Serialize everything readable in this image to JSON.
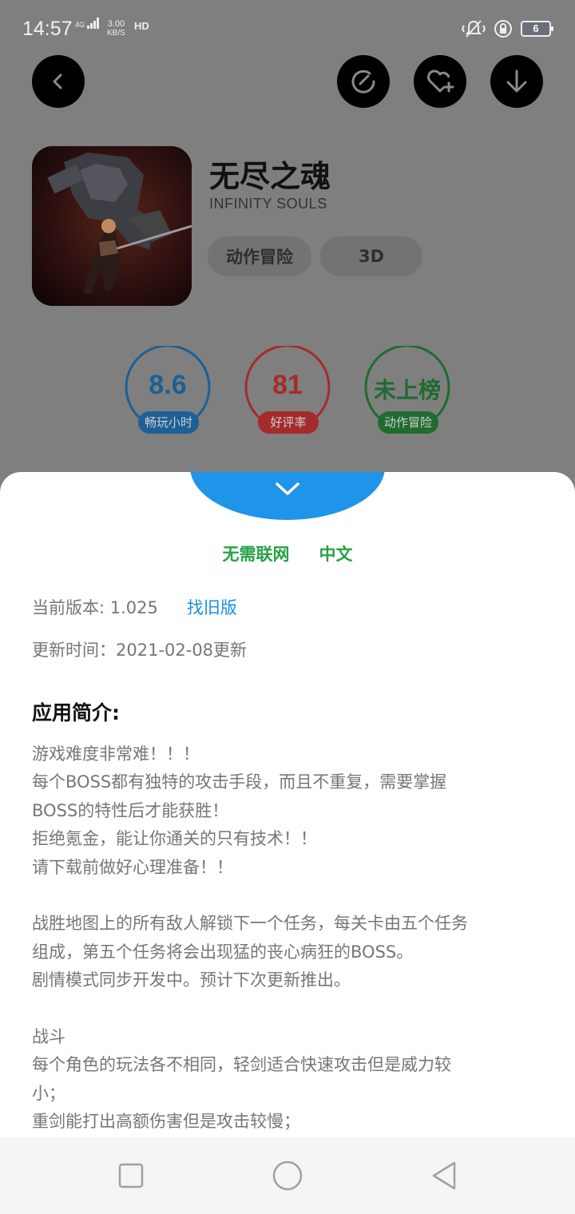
{
  "status_bar": {
    "time": "14:57",
    "network": "4G",
    "speed_value": "3.00",
    "speed_unit": "KB/S",
    "hd": "HD",
    "battery": "6"
  },
  "header": {
    "back_icon": "chevron-left-icon",
    "refresh_icon": "refresh-icon",
    "favorite_icon": "heart-plus-icon",
    "download_icon": "download-icon"
  },
  "app": {
    "title": "无尽之魂",
    "subtitle": "INFINITY SOULS",
    "tags": [
      "动作冒险",
      "3D"
    ]
  },
  "ratings": [
    {
      "value": "8.6",
      "label": "畅玩小时",
      "color": "#1d5f96"
    },
    {
      "value": "81",
      "label": "好评率",
      "color": "#a52b2b"
    },
    {
      "value": "未上榜",
      "label": "动作冒险",
      "color": "#1f6b30"
    }
  ],
  "sheet": {
    "features": [
      "无需联网",
      "中文"
    ],
    "version_label": "当前版本: 1.025",
    "old_version_link": "找旧版",
    "update_label": "更新时间：2021-02-08更新",
    "intro_title": "应用简介:",
    "description_lines": [
      "游戏难度非常难！！！",
      "每个BOSS都有独特的攻击手段，而且不重复，需要掌握",
      "BOSS的特性后才能获胜！",
      "拒绝氪金，能让你通关的只有技术！！",
      "请下载前做好心理准备！！",
      "",
      "战胜地图上的所有敌人解锁下一个任务，每关卡由五个任务",
      "组成，第五个任务将会出现猛的丧心病狂的BOSS。",
      "剧情模式同步开发中。预计下次更新推出。",
      "",
      "战斗",
      "每个角色的玩法各不相同，轻剑适合快速攻击但是威力较",
      "小；",
      "重剑能打出高额伤害但是攻击较慢；"
    ]
  },
  "colors": {
    "accent_blue": "#1e95e8",
    "feature_green": "#25a244",
    "link_blue": "#1b8fdc"
  }
}
